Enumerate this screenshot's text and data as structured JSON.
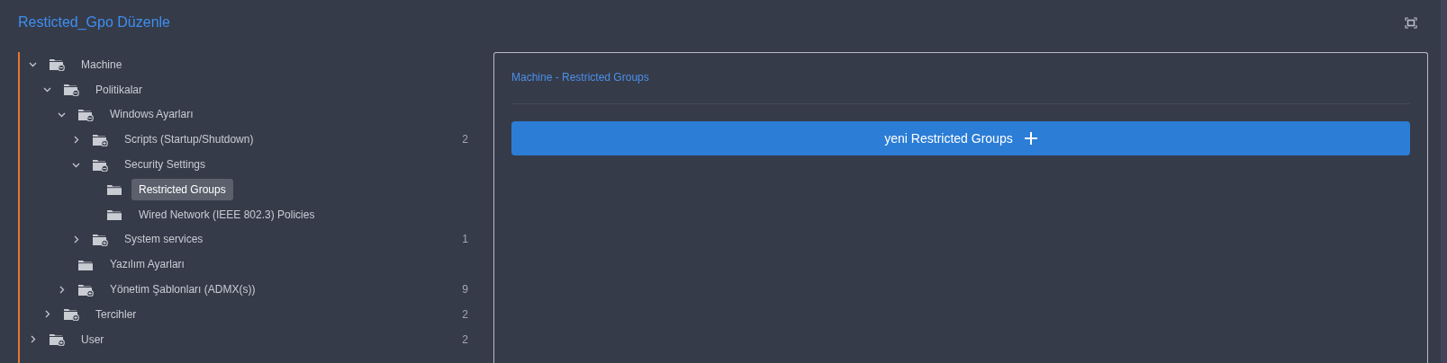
{
  "header": {
    "title": "Resticted_Gpo Düzenle"
  },
  "tree": [
    {
      "label": "Machine",
      "kind": "branch",
      "expanded": true,
      "selected": false,
      "children": [
        {
          "label": "Politikalar",
          "kind": "branch",
          "expanded": true,
          "selected": false,
          "children": [
            {
              "label": "Windows Ayarları",
              "kind": "branch",
              "expanded": true,
              "selected": false,
              "children": [
                {
                  "label": "Scripts (Startup/Shutdown)",
                  "kind": "branch",
                  "expanded": false,
                  "selected": false,
                  "count": "2"
                },
                {
                  "label": "Security Settings",
                  "kind": "branch",
                  "expanded": true,
                  "selected": false,
                  "children": [
                    {
                      "label": "Restricted Groups",
                      "kind": "leaf",
                      "selected": true
                    },
                    {
                      "label": "Wired Network (IEEE 802.3) Policies",
                      "kind": "leaf",
                      "selected": false
                    }
                  ]
                },
                {
                  "label": "System services",
                  "kind": "branch",
                  "expanded": false,
                  "selected": false,
                  "count": "1"
                }
              ]
            },
            {
              "label": "Yazılım Ayarları",
              "kind": "leaf",
              "selected": false
            },
            {
              "label": "Yönetim Şablonları (ADMX(s))",
              "kind": "branch",
              "expanded": false,
              "selected": false,
              "count": "9"
            }
          ]
        },
        {
          "label": "Tercihler",
          "kind": "branch",
          "expanded": false,
          "selected": false,
          "count": "2"
        }
      ]
    },
    {
      "label": "User",
      "kind": "branch",
      "expanded": false,
      "selected": false,
      "count": "2"
    }
  ],
  "panel": {
    "breadcrumb": "Machine - Restricted Groups",
    "add_button": "yeni Restricted Groups"
  }
}
